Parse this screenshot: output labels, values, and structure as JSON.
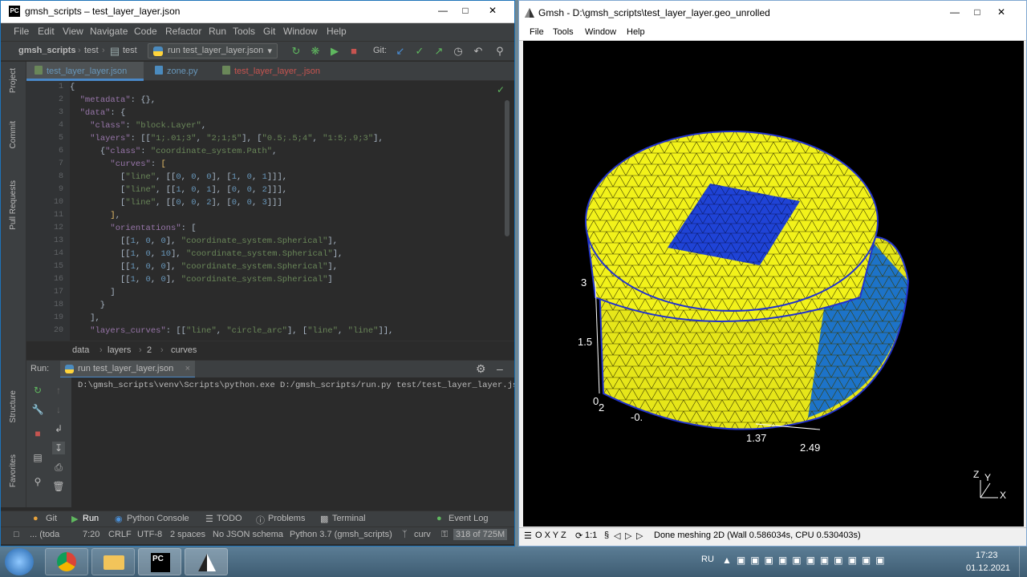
{
  "ide": {
    "title": "gmsh_scripts – test_layer_layer.json",
    "menu": [
      "File",
      "Edit",
      "View",
      "Navigate",
      "Code",
      "Refactor",
      "Run",
      "Tools",
      "Git",
      "Window",
      "Help"
    ],
    "breadcrumb": [
      "gmsh_scripts",
      "test",
      "test"
    ],
    "run_config": "run test_layer_layer.json",
    "git_label": "Git:",
    "tabs": [
      "test_layer_layer.json",
      "zone.py",
      "test_layer_layer_.json"
    ],
    "left_tools": [
      "Project",
      "Commit",
      "Pull Requests",
      "Structure",
      "Favorites"
    ],
    "line_numbers": [
      "1",
      "2",
      "3",
      "4",
      "5",
      "6",
      "7",
      "8",
      "9",
      "10",
      "11",
      "12",
      "13",
      "14",
      "15",
      "16",
      "17",
      "18",
      "19",
      "20"
    ],
    "code_crumb": [
      "data",
      "layers",
      "2",
      "curves"
    ],
    "run_label": "Run:",
    "run_tab": "run test_layer_layer.json",
    "console_cmd": "D:\\gmsh_scripts\\venv\\Scripts\\python.exe D:/gmsh_scripts/run.py test/test_layer_layer.json",
    "bottom_tools": [
      "Git",
      "Run",
      "Python Console",
      "TODO",
      "Problems",
      "Terminal",
      "Event Log"
    ],
    "status": {
      "left": "... (toda",
      "pos": "7:20",
      "eol": "CRLF",
      "enc": "UTF-8",
      "indent": "2 spaces",
      "schema": "No JSON schema",
      "interp": "Python 3.7 (gmsh_scripts)",
      "branch": "curv",
      "mem": "318 of 725M"
    }
  },
  "gmsh": {
    "title": "Gmsh - D:\\gmsh_scripts\\test_layer_layer.geo_unrolled",
    "menu": [
      "File",
      "Tools",
      "Window",
      "Help"
    ],
    "axis_labels": [
      "3",
      "1.5",
      "0",
      "2",
      "-0.",
      "1.37",
      "2.49"
    ],
    "axes_gizmo": [
      "Z",
      "Y",
      "X"
    ],
    "status_buttons": "O X Y Z",
    "scale": "1:1",
    "status_msg": "Done meshing 2D (Wall 0.586034s, CPU 0.530403s)"
  },
  "taskbar": {
    "lang": "RU",
    "time": "17:23",
    "date": "01.12.2021"
  },
  "colors": {
    "ide_bg": "#2b2b2b",
    "string": "#6a8759",
    "key": "#9876aa",
    "number": "#6897bb",
    "mesh_yellow": "#f2f21a",
    "mesh_blue": "#1f43d6"
  }
}
